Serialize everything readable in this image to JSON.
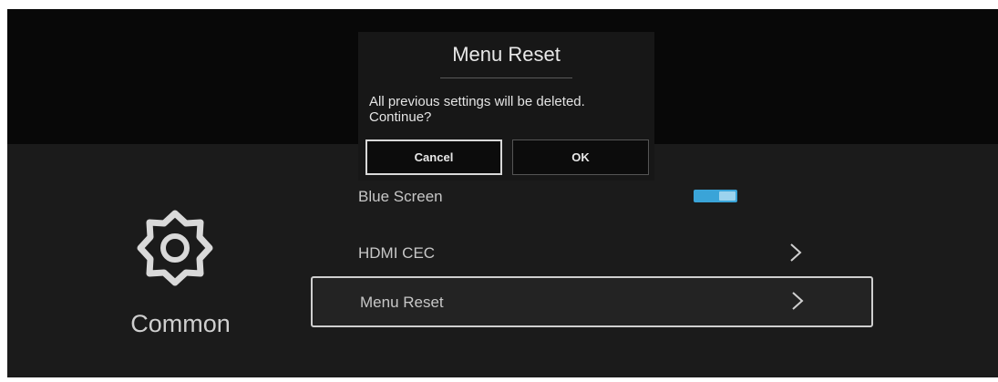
{
  "colors": {
    "background": "#1b1b1b",
    "top_band": "#080808",
    "text": "#c7c7c7",
    "toggle_accent": "#3aa4d8",
    "focus_border": "#cfcfcf"
  },
  "sidebar": {
    "icon": "gear-icon",
    "label": "Common"
  },
  "menu": {
    "items": [
      {
        "label": "Blue Screen",
        "control": "toggle",
        "toggle_on": true
      },
      {
        "label": "HDMI CEC",
        "control": "chevron-right-icon"
      },
      {
        "label": "Menu Reset",
        "control": "chevron-right-icon",
        "focused": true
      }
    ]
  },
  "dialog": {
    "title": "Menu Reset",
    "message": "All previous settings will be deleted.\nContinue?",
    "cancel_label": "Cancel",
    "ok_label": "OK",
    "focused_button": "Cancel"
  }
}
